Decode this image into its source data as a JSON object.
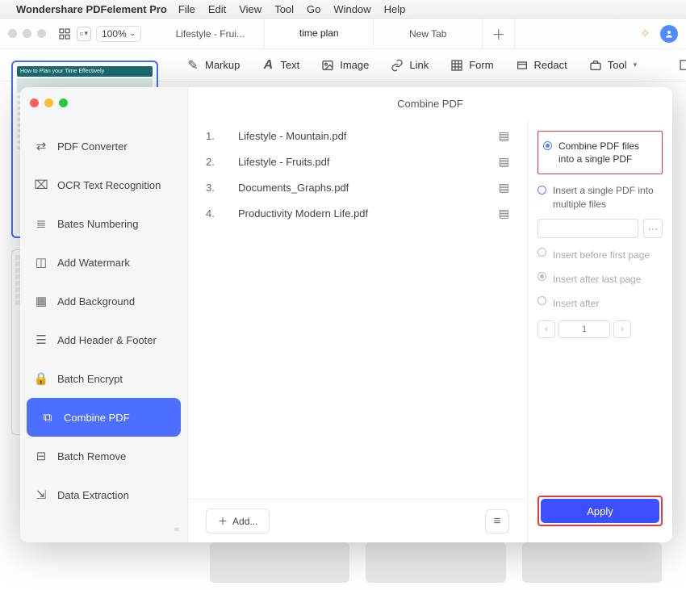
{
  "menubar": {
    "app_name": "Wondershare PDFelement Pro",
    "items": [
      "File",
      "Edit",
      "View",
      "Tool",
      "Go",
      "Window",
      "Help"
    ]
  },
  "toolbar": {
    "zoom": "100%",
    "tabs": [
      {
        "label": "Lifestyle - Frui...",
        "active": false
      },
      {
        "label": "time plan",
        "active": true
      },
      {
        "label": "New Tab",
        "active": false
      }
    ]
  },
  "actionbar": {
    "markup": "Markup",
    "text": "Text",
    "image": "Image",
    "link": "Link",
    "form": "Form",
    "redact": "Redact",
    "tool": "Tool"
  },
  "thumbnail": {
    "title": "How to Plan your Time Effectively"
  },
  "modal": {
    "title": "Combine PDF",
    "sidebar": [
      {
        "id": "pdf-converter",
        "label": "PDF Converter"
      },
      {
        "id": "ocr",
        "label": "OCR Text Recognition"
      },
      {
        "id": "bates",
        "label": "Bates Numbering"
      },
      {
        "id": "watermark",
        "label": "Add Watermark"
      },
      {
        "id": "background",
        "label": "Add Background"
      },
      {
        "id": "headerfooter",
        "label": "Add Header & Footer"
      },
      {
        "id": "encrypt",
        "label": "Batch Encrypt"
      },
      {
        "id": "combine",
        "label": "Combine PDF",
        "selected": true
      },
      {
        "id": "remove",
        "label": "Batch Remove"
      },
      {
        "id": "extract",
        "label": "Data Extraction"
      }
    ],
    "files": [
      {
        "num": "1.",
        "name": "Lifestyle - Mountain.pdf"
      },
      {
        "num": "2.",
        "name": "Lifestyle - Fruits.pdf"
      },
      {
        "num": "3.",
        "name": "Documents_Graphs.pdf"
      },
      {
        "num": "4.",
        "name": "Productivity Modern Life.pdf"
      }
    ],
    "add_label": "Add...",
    "options": {
      "combine_single": "Combine PDF files into a single PDF",
      "insert_multiple": "Insert a single PDF into multiple files",
      "insert_before": "Insert before first page",
      "insert_after_last": "Insert after last page",
      "insert_after": "Insert after",
      "page_value": "1",
      "apply": "Apply"
    }
  }
}
